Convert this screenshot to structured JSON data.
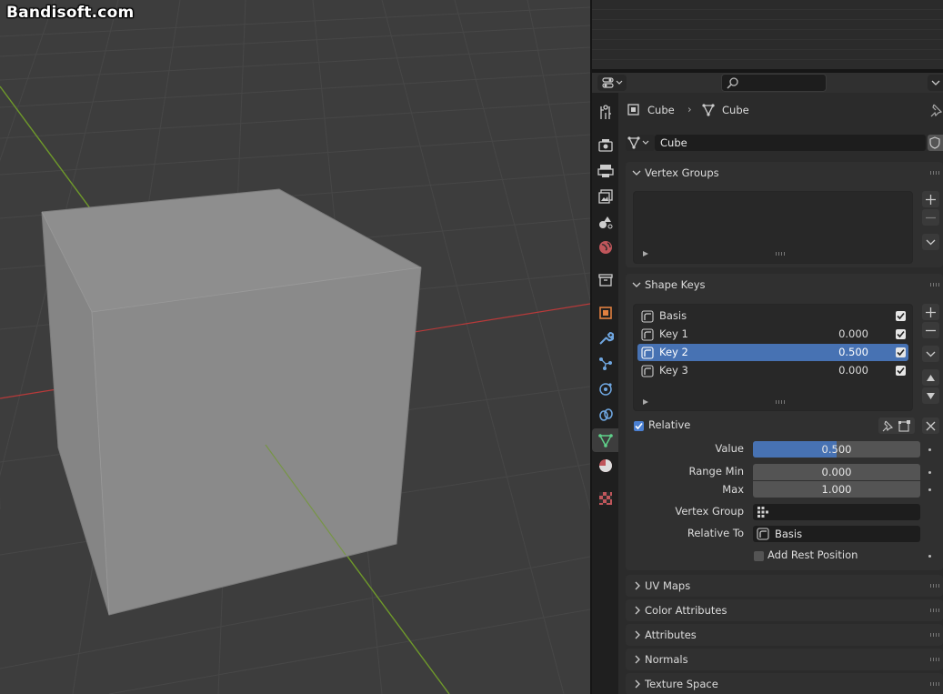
{
  "watermark": "Bandisoft.com",
  "viewport": {
    "background": "#3d3d3d",
    "grid_color": "#4a4a4a",
    "x_axis_color": "#c23b3b",
    "y_axis_color": "#7ba32a",
    "cube_colors": {
      "top": "#8c8c8c",
      "front": "#8a8a8a",
      "side": "#858585"
    }
  },
  "properties": {
    "search_placeholder": "",
    "breadcrumb": {
      "object": "Cube",
      "separator": "›",
      "mesh": "Cube"
    },
    "mesh_datablock_name": "Cube",
    "tabs": [
      "tool-icon",
      "render-icon",
      "output-icon",
      "view-layer-icon",
      "scene-icon",
      "world-icon",
      "collection-icon",
      "object-icon",
      "modifier-icon",
      "particles-icon",
      "physics-icon",
      "constraints-icon",
      "data-icon",
      "material-icon",
      "texture-icon"
    ],
    "active_tab": "data-icon",
    "vertex_groups": {
      "title": "Vertex Groups"
    },
    "shape_keys": {
      "title": "Shape Keys",
      "items": [
        {
          "name": "Basis",
          "value": "",
          "checked": true
        },
        {
          "name": "Key 1",
          "value": "0.000",
          "checked": true
        },
        {
          "name": "Key 2",
          "value": "0.500",
          "checked": true,
          "selected": true
        },
        {
          "name": "Key 3",
          "value": "0.000",
          "checked": true
        }
      ],
      "relative_label": "Relative",
      "relative_checked": true,
      "value_label": "Value",
      "value": "0.500",
      "value_fraction": 0.5,
      "range_min_label": "Range Min",
      "range_min": "0.000",
      "max_label": "Max",
      "max": "1.000",
      "vertex_group_label": "Vertex Group",
      "vertex_group_value": "",
      "relative_to_label": "Relative To",
      "relative_to_value": "Basis",
      "add_rest_position_label": "Add Rest Position",
      "add_rest_position_checked": false
    },
    "collapsed_panels": [
      "UV Maps",
      "Color Attributes",
      "Attributes",
      "Normals",
      "Texture Space"
    ]
  }
}
